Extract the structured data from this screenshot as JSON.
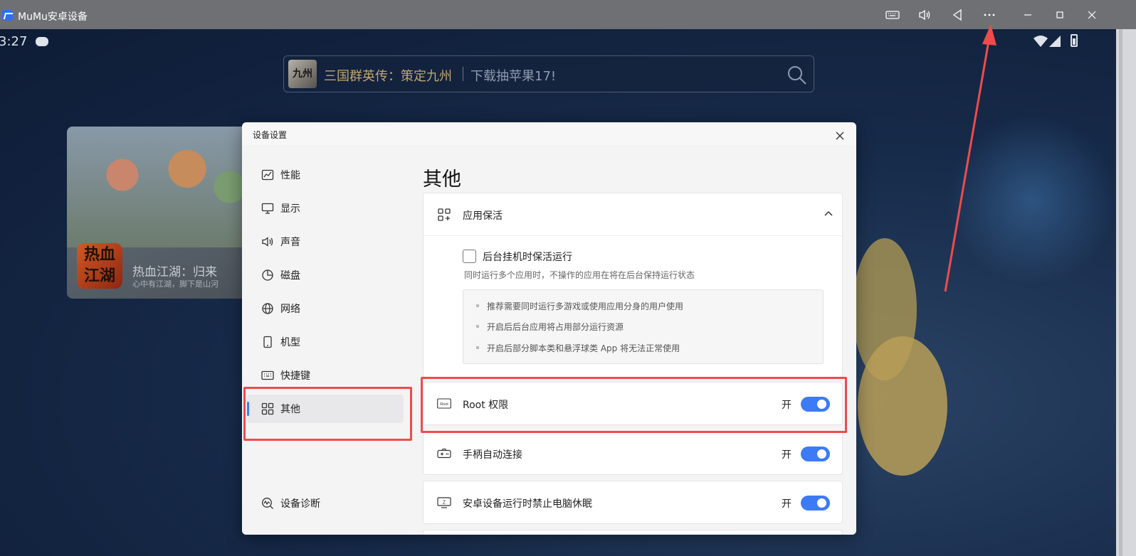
{
  "window": {
    "title": "MuMu安卓设备",
    "controls": [
      "keyboard-icon",
      "volume-icon",
      "back-icon",
      "more-icon",
      "minimize-icon",
      "maximize-icon",
      "close-icon"
    ]
  },
  "android": {
    "time": "3:27",
    "search": {
      "thumb_text": "九州",
      "title": "三国群英传：策定九州",
      "promo": "下载抽苹果17!"
    },
    "game_card": {
      "icon_text": "热血江湖",
      "name": "热血江湖：归来",
      "tagline": "心中有江湖，脚下是山河"
    }
  },
  "dialog": {
    "title": "设备设置",
    "sidebar": {
      "items": [
        {
          "label": "性能",
          "icon": "performance-icon"
        },
        {
          "label": "显示",
          "icon": "monitor-icon"
        },
        {
          "label": "声音",
          "icon": "speaker-icon"
        },
        {
          "label": "磁盘",
          "icon": "pie-chart-icon"
        },
        {
          "label": "网络",
          "icon": "globe-icon"
        },
        {
          "label": "机型",
          "icon": "phone-icon"
        },
        {
          "label": "快捷键",
          "icon": "keyboard-icon"
        },
        {
          "label": "其他",
          "icon": "grid-icon"
        }
      ],
      "active": "其他",
      "diagnostics": "设备诊断"
    },
    "main": {
      "page_title": "其他",
      "keepalive": {
        "header": "应用保活",
        "checkbox_label": "后台挂机时保活运行",
        "checkbox_checked": false,
        "description": "同时运行多个应用时，不操作的应用在将在后台保持运行状态",
        "tips": [
          "推荐需要同时运行多游戏或使用应用分身的用户使用",
          "开启后后台应用将占用部分运行资源",
          "开启后部分脚本类和悬浮球类 App 将无法正常使用"
        ]
      },
      "root": {
        "icon_text": "Root",
        "label": "Root 权限",
        "state": "开",
        "on": true
      },
      "gamepad": {
        "label": "手柄自动连接",
        "state": "开",
        "on": true
      },
      "nosleep": {
        "icon_text": "Z",
        "label": "安卓设备运行时禁止电脑休眠",
        "state": "开",
        "on": true
      }
    }
  },
  "colors": {
    "accent": "#3d7af5",
    "highlight": "#ef4b4b",
    "titlebar": "#6f7073"
  }
}
